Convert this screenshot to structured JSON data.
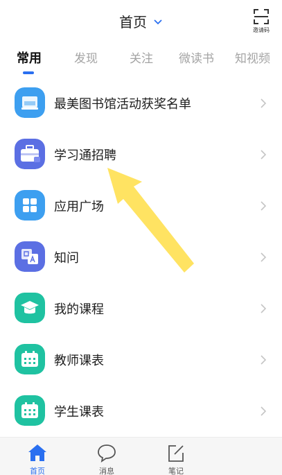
{
  "header": {
    "title": "首页",
    "scan_label": "邀请码"
  },
  "tabs": [
    {
      "label": "常用",
      "active": true
    },
    {
      "label": "发现",
      "active": false
    },
    {
      "label": "关注",
      "active": false
    },
    {
      "label": "微读书",
      "active": false
    },
    {
      "label": "知视频",
      "active": false
    }
  ],
  "list": [
    {
      "label": "最美图书馆活动获奖名单",
      "icon": "library-award-icon",
      "color": "#3d9ff0"
    },
    {
      "label": "学习通招聘",
      "icon": "briefcase-icon",
      "color": "#5b6fe3"
    },
    {
      "label": "应用广场",
      "icon": "app-grid-icon",
      "color": "#3d9ff0"
    },
    {
      "label": "知问",
      "icon": "qa-icon",
      "color": "#5b6fe3"
    },
    {
      "label": "我的课程",
      "icon": "graduation-cap-icon",
      "color": "#1fc2a1"
    },
    {
      "label": "教师课表",
      "icon": "calendar-icon",
      "color": "#1fc2a1"
    },
    {
      "label": "学生课表",
      "icon": "calendar-icon",
      "color": "#1fc2a1"
    }
  ],
  "tabbar": [
    {
      "label": "首页",
      "icon": "home-icon",
      "active": true
    },
    {
      "label": "消息",
      "icon": "chat-bubble-icon",
      "active": false
    },
    {
      "label": "笔记",
      "icon": "note-edit-icon",
      "active": false
    }
  ],
  "colors": {
    "accent": "#2a6ff0",
    "arrow": "#ffe25a"
  }
}
